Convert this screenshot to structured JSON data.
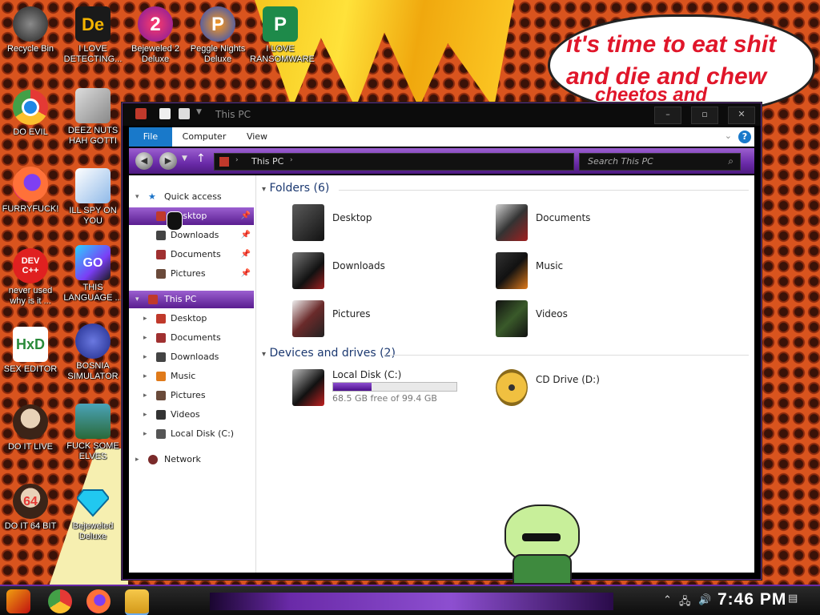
{
  "desktop": {
    "bubble_lines": [
      "it's time to eat shit",
      "and die and chew",
      "cheetos and"
    ],
    "icons": [
      {
        "label": "Recycle Bin"
      },
      {
        "label": "I LOVE DETECTING..."
      },
      {
        "label": "Bejeweled 2 Deluxe"
      },
      {
        "label": "Peggle Nights Deluxe"
      },
      {
        "label": "I LOVE RANSOMWARE"
      },
      {
        "label": "DO EVIL"
      },
      {
        "label": "DEEZ NUTS HAH GOTTI"
      },
      {
        "label": "FURRYFUCK!"
      },
      {
        "label": "ILL SPY ON YOU"
      },
      {
        "label": "never used why is it ..."
      },
      {
        "label": "THIS LANGUAGE ..."
      },
      {
        "label": "SEX EDITOR"
      },
      {
        "label": "BOSNIA SIMULATOR"
      },
      {
        "label": "DO IT LIVE"
      },
      {
        "label": "FUCK SOME ELVES"
      },
      {
        "label": "DO IT 64 BIT"
      },
      {
        "label": "Bejeweled Deluxe"
      }
    ],
    "icon_text": {
      "dev": "DEV\nC++",
      "go": "GO",
      "de": "De",
      "hxd": "HxD",
      "sixtyfour": "64"
    }
  },
  "window": {
    "title": "This PC",
    "buttons": {
      "minimize": "–",
      "maximize": "▫",
      "close": "✕"
    },
    "ribbon_tabs": [
      "File",
      "Computer",
      "View"
    ],
    "address": {
      "location": "This PC"
    },
    "search_placeholder": "Search This PC",
    "nav": {
      "quick_access": "Quick access",
      "quick_items": [
        "Desktop",
        "Downloads",
        "Documents",
        "Pictures"
      ],
      "this_pc": "This PC",
      "pc_items": [
        "Desktop",
        "Documents",
        "Downloads",
        "Music",
        "Pictures",
        "Videos",
        "Local Disk (C:)"
      ],
      "network": "Network"
    },
    "folders_header": "Folders (6)",
    "folders": [
      "Desktop",
      "Documents",
      "Downloads",
      "Music",
      "Pictures",
      "Videos"
    ],
    "devices_header": "Devices and drives (2)",
    "drives": [
      {
        "name": "Local Disk (C:)",
        "free_text": "68.5 GB free of 99.4 GB",
        "used_fraction": 0.311
      },
      {
        "name": "CD Drive (D:)"
      }
    ]
  },
  "taskbar": {
    "clock": "7:46 PM"
  },
  "colors": {
    "accent": "#6a2aa8",
    "file_tab": "#1979ca",
    "wallpaper": "#d9541e"
  }
}
